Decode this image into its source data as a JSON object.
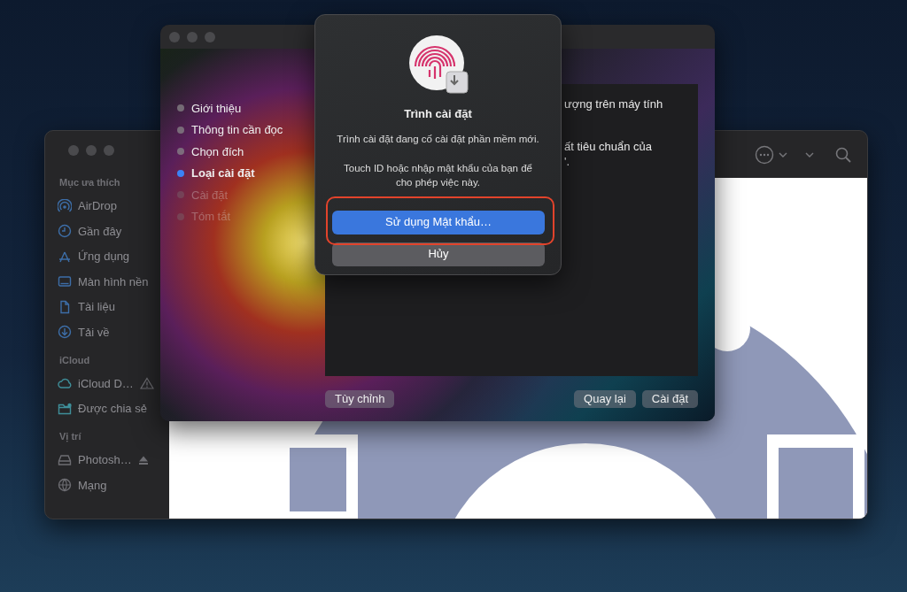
{
  "finder": {
    "sidebar": [
      {
        "heading": "Mục ưa thích",
        "items": [
          {
            "label": "AirDrop"
          },
          {
            "label": "Gần đây"
          },
          {
            "label": "Ứng dụng"
          },
          {
            "label": "Màn hình nền"
          },
          {
            "label": "Tài liệu"
          },
          {
            "label": "Tải về"
          }
        ]
      },
      {
        "heading": "iCloud",
        "items": [
          {
            "label": "iCloud D…",
            "warning": true,
            "ejectable": false
          },
          {
            "label": "Được chia sẻ",
            "warning": false,
            "ejectable": false
          }
        ]
      },
      {
        "heading": "Vị trí",
        "items": [
          {
            "label": "Photosh…",
            "warning": false,
            "ejectable": true
          },
          {
            "label": "Mạng",
            "warning": false,
            "ejectable": false
          }
        ]
      }
    ]
  },
  "installer": {
    "steps": [
      {
        "label": "Giới thiệu",
        "selected": false,
        "disabled": false
      },
      {
        "label": "Thông tin cần đọc",
        "selected": false,
        "disabled": false
      },
      {
        "label": "Chọn đích",
        "selected": false,
        "disabled": false
      },
      {
        "label": "Loại cài đặt",
        "selected": true,
        "disabled": false
      },
      {
        "label": "Cài đặt",
        "selected": false,
        "disabled": true
      },
      {
        "label": "Tóm tắt",
        "selected": false,
        "disabled": true
      }
    ],
    "panel_lines": [
      "ượng trên máy tính",
      "ất tiêu chuẩn của",
      "'."
    ],
    "left_button": "Tùy chỉnh",
    "right_buttons": [
      "Quay lại",
      "Cài đặt"
    ]
  },
  "dialog": {
    "title": "Trình cài đặt",
    "message": "Trình cài đặt đang cố cài đặt phần mềm mới.",
    "prompt": "Touch ID hoặc nhập mật khẩu của bạn để cho phép việc này.",
    "buttons": [
      {
        "label": "Sử dụng Mật khẩu…",
        "kind": "primary",
        "highlighted": true
      },
      {
        "label": "Hủy",
        "kind": "cancel",
        "highlighted": false
      }
    ]
  }
}
